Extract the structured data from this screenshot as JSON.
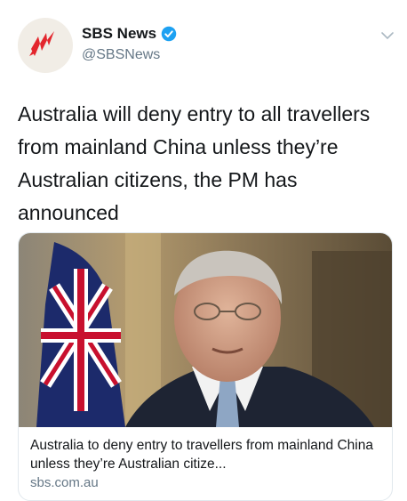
{
  "tweet": {
    "author": {
      "display_name": "SBS News",
      "handle": "@SBSNews",
      "verified": true,
      "avatar_icon": "sbs-logo-icon"
    },
    "text": "Australia will deny entry to all travellers from mainland China unless they’re Australian citizens, the PM has announced",
    "menu_icon": "chevron-down-icon"
  },
  "link_card": {
    "title": "Australia to deny entry to travellers from mainland China unless they’re Australian citize...",
    "domain": "sbs.com.au"
  },
  "colors": {
    "brand_red": "#e3262d",
    "verified_blue": "#1da1f2",
    "secondary_text": "#657786"
  }
}
